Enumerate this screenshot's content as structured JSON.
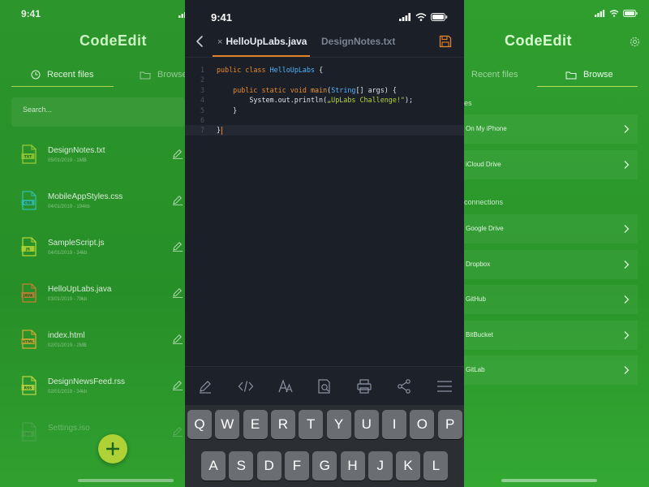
{
  "left": {
    "time": "9:41",
    "app_title": "CodeEdit",
    "tabs": {
      "recent": "Recent files",
      "browse": "Browse"
    },
    "search_placeholder": "Search...",
    "files": [
      {
        "name": "DesignNotes.txt",
        "meta": "05/01/2019 - 1MB",
        "type": "TXT",
        "color": "#9fd63a"
      },
      {
        "name": "MobileAppStyles.css",
        "meta": "04/01/2019 - 194kb",
        "type": "CSS",
        "color": "#35c6b8"
      },
      {
        "name": "SampleScript.js",
        "meta": "04/01/2019 - 34kb",
        "type": "JS",
        "color": "#bfe03a"
      },
      {
        "name": "HelloUpLabs.java",
        "meta": "03/01/2019 - 78kb",
        "type": "JAVA",
        "color": "#d4843a"
      },
      {
        "name": "index.html",
        "meta": "02/01/2019 - 2MB",
        "type": "HTML",
        "color": "#e3b33a"
      },
      {
        "name": "DesignNewsFeed.rss",
        "meta": "02/01/2019 - 34kb",
        "type": "RSS",
        "color": "#c4e04a"
      },
      {
        "name": "Settings.iso",
        "meta": "",
        "type": "ISO",
        "color": "#7fbf7f"
      }
    ],
    "fab_label": "+"
  },
  "editor": {
    "time": "9:41",
    "active_tab": "HelloUpLabs.java",
    "close_glyph": "×",
    "inactive_tab": "DesignNotes.txt",
    "lines": [
      {
        "n": "1",
        "segments": [
          [
            "kw",
            "public class "
          ],
          [
            "cls",
            "HelloUpLabs"
          ],
          [
            "pl",
            " {"
          ]
        ]
      },
      {
        "n": "2",
        "segments": []
      },
      {
        "n": "3",
        "segments": [
          [
            "pl",
            "    "
          ],
          [
            "kw",
            "public static void "
          ],
          [
            "fn",
            "main"
          ],
          [
            "pl",
            "("
          ],
          [
            "ty",
            "String"
          ],
          [
            "pl",
            "[] args) {"
          ]
        ]
      },
      {
        "n": "4",
        "segments": [
          [
            "pl",
            "        System.out.println("
          ],
          [
            "str",
            "„UpLabs Challenge!\""
          ],
          [
            "pl",
            ");"
          ]
        ]
      },
      {
        "n": "5",
        "segments": [
          [
            "pl",
            "    }"
          ]
        ]
      },
      {
        "n": "6",
        "segments": []
      },
      {
        "n": "7",
        "segments": [
          [
            "pl",
            "}"
          ]
        ],
        "cursor": true
      }
    ],
    "keyboard_rows": [
      [
        "Q",
        "W",
        "E",
        "R",
        "T",
        "Y",
        "U",
        "I",
        "O",
        "P"
      ],
      [
        "A",
        "S",
        "D",
        "F",
        "G",
        "H",
        "J",
        "K",
        "L"
      ]
    ]
  },
  "right": {
    "app_title": "CodeEdit",
    "tabs": {
      "recent": "Recent files",
      "browse": "Browse"
    },
    "section_local": "es",
    "section_connections": "connections",
    "locations_local": [
      "On My iPhone",
      "iCloud Drive"
    ],
    "locations_remote": [
      "Google Drive",
      "Dropbox",
      "GitHub",
      "BitBucket",
      "GitLab"
    ]
  },
  "colors": {
    "accent_orange": "#e1822a",
    "accent_lime": "#b9de3a",
    "editor_bg": "#1b1f27",
    "green_bg": "#2a9a2a"
  }
}
